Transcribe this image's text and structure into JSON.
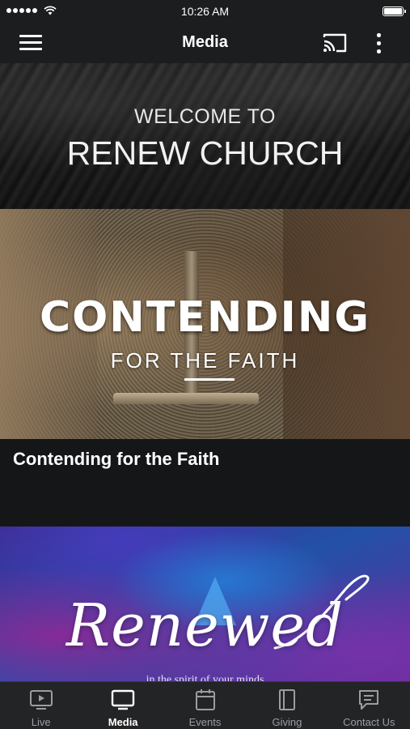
{
  "status_bar": {
    "time": "10:26 AM"
  },
  "nav": {
    "title": "Media",
    "menu_icon": "hamburger-menu-icon",
    "cast_icon": "cast-icon",
    "more_icon": "more-vertical-icon"
  },
  "welcome": {
    "line1": "WELCOME TO",
    "line2": "RENEW CHURCH"
  },
  "media_items": [
    {
      "art_title": "CONTENDING",
      "art_subtitle": "FOR THE FAITH",
      "caption": "Contending for the Faith"
    },
    {
      "art_title": "Renewed",
      "art_subtitle": "in the spirit of your minds"
    }
  ],
  "tabs": [
    {
      "label": "Live",
      "icon": "play-screen-icon",
      "active": false
    },
    {
      "label": "Media",
      "icon": "tv-icon",
      "active": true
    },
    {
      "label": "Events",
      "icon": "calendar-icon",
      "active": false
    },
    {
      "label": "Giving",
      "icon": "book-icon",
      "active": false
    },
    {
      "label": "Contact Us",
      "icon": "message-icon",
      "active": false
    }
  ],
  "colors": {
    "background": "#151617",
    "bar": "#1c1d1f",
    "tab_inactive": "#9c9da0",
    "tab_active": "#ffffff"
  }
}
